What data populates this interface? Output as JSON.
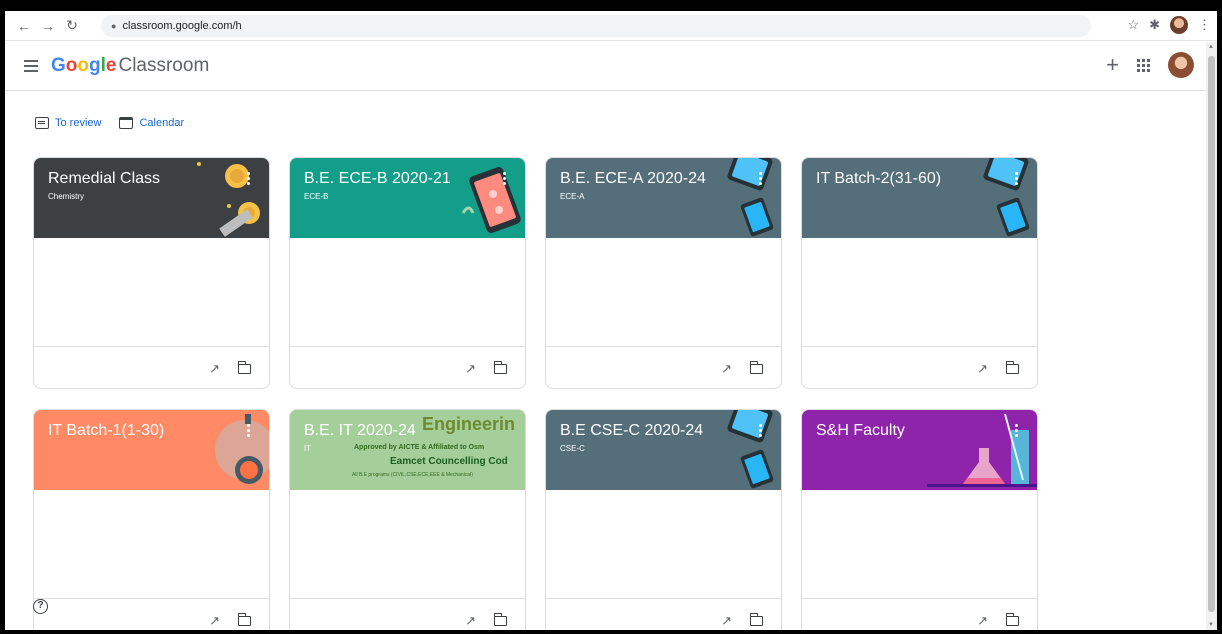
{
  "browser": {
    "url": "classroom.google.com/h",
    "back_icon": "arrow-left-icon",
    "forward_icon": "arrow-right-icon",
    "reload_icon": "reload-icon"
  },
  "app": {
    "brand_google": [
      "G",
      "o",
      "o",
      "g",
      "l",
      "e"
    ],
    "brand_google_colors": [
      "#4285f4",
      "#ea4335",
      "#fbbc05",
      "#4285f4",
      "#34a853",
      "#ea4335"
    ],
    "brand_product": "Classroom"
  },
  "links": {
    "to_review": "To review",
    "calendar": "Calendar"
  },
  "help": "?",
  "cards": [
    {
      "title": "Remedial Class",
      "subtitle": "Chemistry",
      "color": "#3c4043"
    },
    {
      "title": "B.E. ECE-B 2020-21",
      "subtitle": "ECE-B",
      "color": "#129e89"
    },
    {
      "title": "B.E. ECE-A 2020-24",
      "subtitle": "ECE-A",
      "color": "#546e7a"
    },
    {
      "title": "IT Batch-2(31-60)",
      "subtitle": "",
      "color": "#546e7a"
    },
    {
      "title": "IT Batch-1(1-30)",
      "subtitle": "",
      "color": "#ff8a65"
    },
    {
      "title": "B.E. IT 2020-24",
      "subtitle": "IT",
      "color": "#3fa34d",
      "banner_lines": [
        "Engineerin",
        "Approved by AICTE & Affiliated to Osm",
        "Eamcet Councelling Cod",
        "All B.E programs (CIVIL,CSE,ECE,EEE & Mechanical)"
      ]
    },
    {
      "title": "B.E CSE-C 2020-24",
      "subtitle": "CSE-C",
      "color": "#546e7a"
    },
    {
      "title": "S&H Faculty",
      "subtitle": "",
      "color": "#8e24aa"
    }
  ]
}
